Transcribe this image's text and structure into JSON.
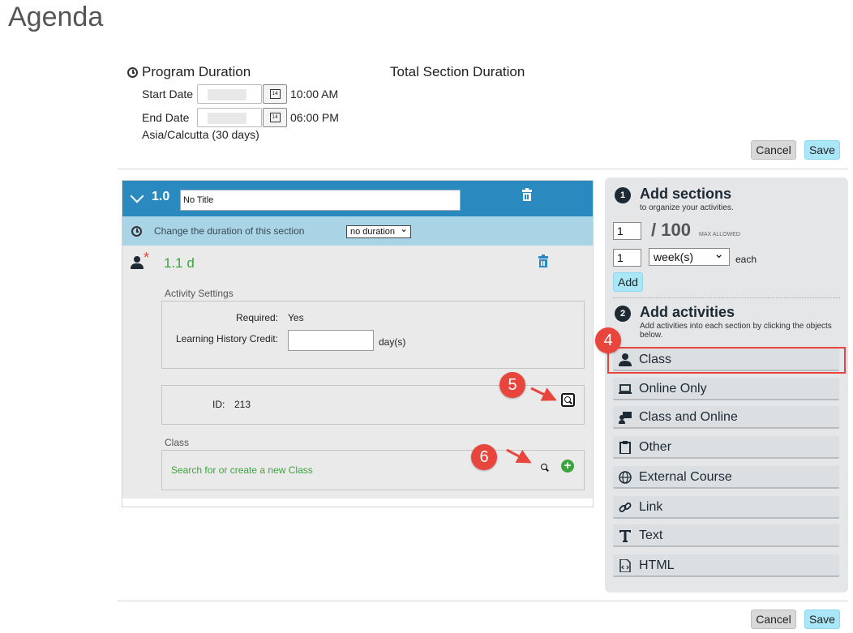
{
  "page": {
    "title": "Agenda"
  },
  "program": {
    "duration_label": "Program Duration",
    "total_label": "Total Section Duration",
    "start_label": "Start Date",
    "start_time": "10:00 AM",
    "end_label": "End Date",
    "end_time": "06:00 PM",
    "timezone": "Asia/Calcutta (30 days)",
    "calendar_glyph": "14"
  },
  "buttons": {
    "cancel": "Cancel",
    "save": "Save",
    "add": "Add"
  },
  "section": {
    "number": "1.0",
    "title_value": "No Title",
    "duration_prompt": "Change the duration of this section",
    "duration_select": "no duration"
  },
  "activity": {
    "name": "1.1 d",
    "required_marker": "*",
    "settings_label": "Activity Settings",
    "required_label": "Required:",
    "required_value": "Yes",
    "lhc_label": "Learning History Credit:",
    "lhc_unit": "day(s)",
    "id_label": "ID:",
    "id_value": "213",
    "class_label": "Class",
    "class_link": "Search for or create a new Class"
  },
  "callouts": {
    "four": "4",
    "five": "5",
    "six": "6"
  },
  "sidebar": {
    "step1_num": "1",
    "step1_title": "Add sections",
    "step1_sub": "to organize your activities.",
    "count_value": "1",
    "max_value": "/ 100",
    "max_note": "MAX ALLOWED",
    "duration_value": "1",
    "unit_value": "week(s)",
    "each_label": "each",
    "step2_num": "2",
    "step2_title": "Add activities",
    "step2_sub": "Add activities into each section by clicking the objects below.",
    "activities": [
      {
        "label": "Class",
        "icon": "person-icon"
      },
      {
        "label": "Online Only",
        "icon": "laptop-icon"
      },
      {
        "label": "Class and Online",
        "icon": "person-screen-icon"
      },
      {
        "label": "Other",
        "icon": "clipboard-icon"
      },
      {
        "label": "External Course",
        "icon": "globe-icon"
      },
      {
        "label": "Link",
        "icon": "link-icon"
      },
      {
        "label": "Text",
        "icon": "text-icon"
      },
      {
        "label": "HTML",
        "icon": "html-file-icon"
      }
    ]
  },
  "colors": {
    "header_blue": "#2a8ac0",
    "duration_bar": "#a9d4e6",
    "accent_green": "#3ca43c",
    "callout_red": "#e8453c",
    "save_blue": "#a8e6f8"
  }
}
